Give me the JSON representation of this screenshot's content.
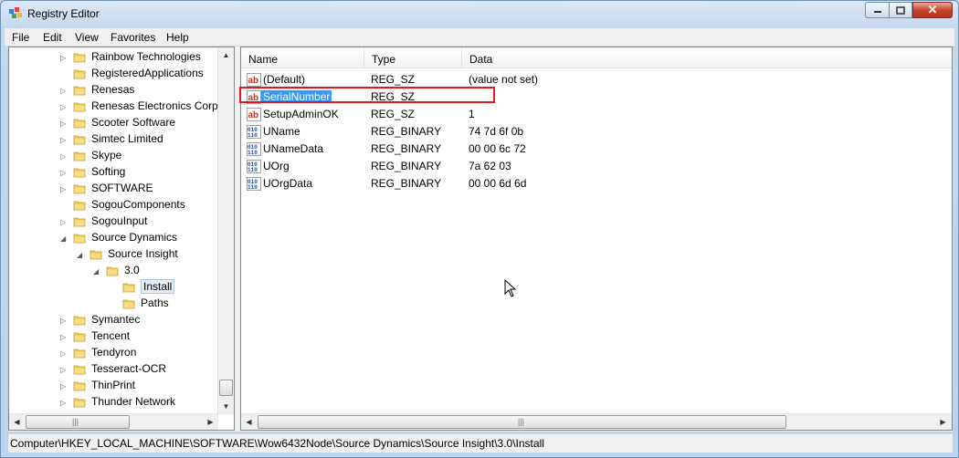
{
  "window": {
    "title": "Registry Editor"
  },
  "menu": [
    "File",
    "Edit",
    "View",
    "Favorites",
    "Help"
  ],
  "tree": [
    {
      "label": "Rainbow Technologies",
      "depth": 0,
      "expander": "collapsed"
    },
    {
      "label": "RegisteredApplications",
      "depth": 0,
      "expander": "none"
    },
    {
      "label": "Renesas",
      "depth": 0,
      "expander": "collapsed"
    },
    {
      "label": "Renesas Electronics Corpor",
      "depth": 0,
      "expander": "collapsed"
    },
    {
      "label": "Scooter Software",
      "depth": 0,
      "expander": "collapsed"
    },
    {
      "label": "Simtec Limited",
      "depth": 0,
      "expander": "collapsed"
    },
    {
      "label": "Skype",
      "depth": 0,
      "expander": "collapsed"
    },
    {
      "label": "Softing",
      "depth": 0,
      "expander": "collapsed"
    },
    {
      "label": "SOFTWARE",
      "depth": 0,
      "expander": "collapsed"
    },
    {
      "label": "SogouComponents",
      "depth": 0,
      "expander": "none"
    },
    {
      "label": "SogouInput",
      "depth": 0,
      "expander": "collapsed"
    },
    {
      "label": "Source Dynamics",
      "depth": 0,
      "expander": "expanded"
    },
    {
      "label": "Source Insight",
      "depth": 1,
      "expander": "expanded"
    },
    {
      "label": "3.0",
      "depth": 2,
      "expander": "expanded"
    },
    {
      "label": "Install",
      "depth": 3,
      "expander": "none",
      "selected": true
    },
    {
      "label": "Paths",
      "depth": 3,
      "expander": "none"
    },
    {
      "label": "Symantec",
      "depth": 0,
      "expander": "collapsed"
    },
    {
      "label": "Tencent",
      "depth": 0,
      "expander": "collapsed"
    },
    {
      "label": "Tendyron",
      "depth": 0,
      "expander": "collapsed"
    },
    {
      "label": "Tesseract-OCR",
      "depth": 0,
      "expander": "collapsed"
    },
    {
      "label": "ThinPrint",
      "depth": 0,
      "expander": "collapsed"
    },
    {
      "label": "Thunder Network",
      "depth": 0,
      "expander": "collapsed"
    }
  ],
  "list": {
    "columns": [
      "Name",
      "Type",
      "Data"
    ],
    "rows": [
      {
        "name": "(Default)",
        "type": "REG_SZ",
        "data": "(value not set)",
        "icon": "string-value-icon"
      },
      {
        "name": "SerialNumber",
        "type": "REG_SZ",
        "data": "",
        "icon": "string-value-icon",
        "selected": true
      },
      {
        "name": "SetupAdminOK",
        "type": "REG_SZ",
        "data": "1",
        "icon": "string-value-icon"
      },
      {
        "name": "UName",
        "type": "REG_BINARY",
        "data": "74 7d 6f 0b",
        "icon": "binary-value-icon"
      },
      {
        "name": "UNameData",
        "type": "REG_BINARY",
        "data": "00 00 6c 72",
        "icon": "binary-value-icon"
      },
      {
        "name": "UOrg",
        "type": "REG_BINARY",
        "data": "7a 62 03",
        "icon": "binary-value-icon"
      },
      {
        "name": "UOrgData",
        "type": "REG_BINARY",
        "data": "00 00 6d 6d",
        "icon": "binary-value-icon"
      }
    ]
  },
  "status": {
    "path": "Computer\\HKEY_LOCAL_MACHINE\\SOFTWARE\\Wow6432Node\\Source Dynamics\\Source Insight\\3.0\\Install"
  },
  "colors": {
    "selection": "#3399ff",
    "highlight_box": "#e8141e",
    "folder": "#f2c94c"
  }
}
